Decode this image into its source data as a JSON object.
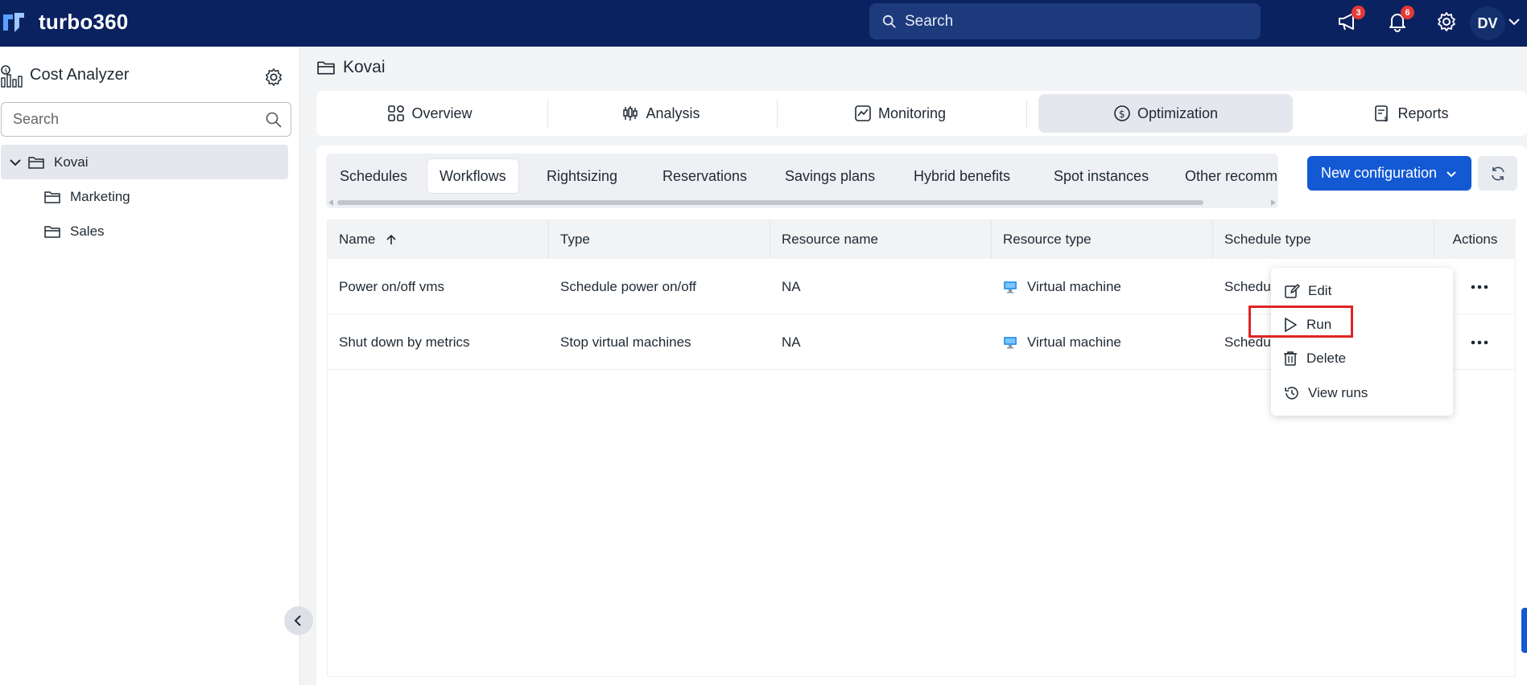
{
  "app": {
    "brand": "turbo360"
  },
  "header": {
    "search_placeholder": "Search",
    "announcements_count": "3",
    "notifications_count": "6",
    "user_initials": "DV"
  },
  "sidebar": {
    "title": "Cost Analyzer",
    "search_placeholder": "Search",
    "tree": {
      "root": "Kovai",
      "children": [
        "Marketing",
        "Sales"
      ]
    }
  },
  "breadcrumb": {
    "label": "Kovai"
  },
  "main_tabs": [
    "Overview",
    "Analysis",
    "Monitoring",
    "Optimization",
    "Reports"
  ],
  "sub_tabs": [
    "Schedules",
    "Workflows",
    "Rightsizing",
    "Reservations",
    "Savings plans",
    "Hybrid benefits",
    "Spot instances",
    "Other recomm"
  ],
  "toolbar": {
    "new_configuration": "New configuration"
  },
  "table": {
    "columns": [
      "Name",
      "Type",
      "Resource name",
      "Resource type",
      "Schedule type",
      "Actions"
    ],
    "rows": [
      {
        "name": "Power on/off vms",
        "type": "Schedule power on/off",
        "resource_name": "NA",
        "resource_type": "Virtual machine",
        "schedule_type": "Schedu"
      },
      {
        "name": "Shut down by metrics",
        "type": "Stop virtual machines",
        "resource_name": "NA",
        "resource_type": "Virtual machine",
        "schedule_type": "Schedu"
      }
    ]
  },
  "context_menu": {
    "items": [
      "Edit",
      "Run",
      "Delete",
      "View runs"
    ]
  },
  "colors": {
    "topbar": "#0b2260",
    "accent": "#1359d4",
    "highlight": "#e02424"
  }
}
